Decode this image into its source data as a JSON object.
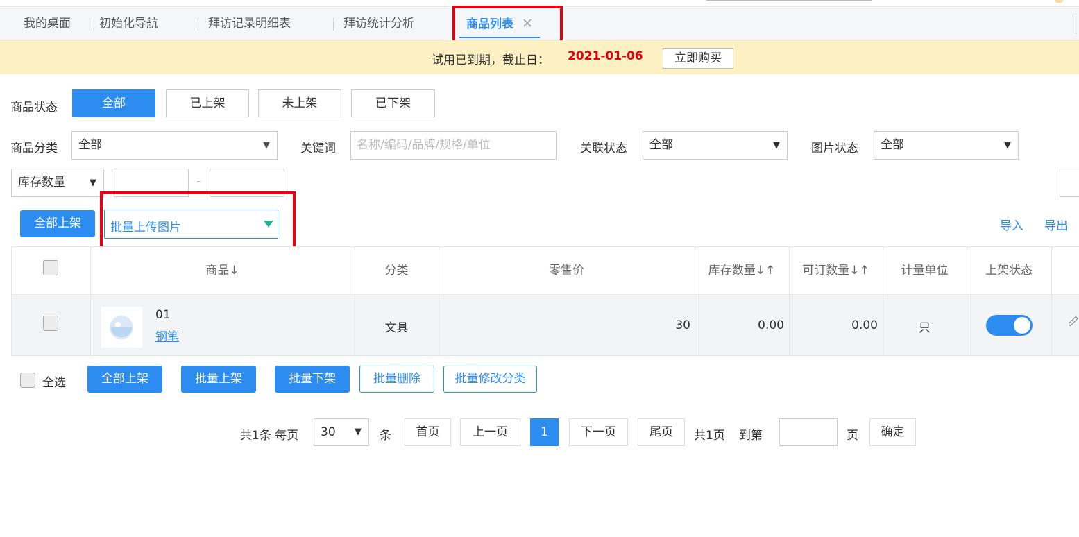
{
  "tabs": [
    {
      "label": "我的桌面"
    },
    {
      "label": "初始化导航"
    },
    {
      "label": "拜访记录明细表"
    },
    {
      "label": "拜访统计分析"
    },
    {
      "label": "商品列表",
      "close": "✕"
    }
  ],
  "banner": {
    "message": "试用已到期，截止日：",
    "expire_date": "2021-01-06",
    "buy_label": "立即购买"
  },
  "filters": {
    "status_label": "商品状态",
    "status_options": [
      "全部",
      "已上架",
      "未上架",
      "已下架"
    ],
    "category_label": "商品分类",
    "category_value": "全部",
    "keyword_label": "关键词",
    "keyword_placeholder": "名称/编码/品牌/规格/单位",
    "link_status_label": "关联状态",
    "link_status_value": "全部",
    "image_status_label": "图片状态",
    "image_status_value": "全部",
    "stock_field": "库存数量",
    "range_sep": "-"
  },
  "toolbar": {
    "all_on_shelf": "全部上架",
    "batch_upload": "批量上传图片",
    "import": "导入",
    "export": "导出"
  },
  "table": {
    "headers": [
      "商品↓",
      "分类",
      "零售价",
      "库存数量↓↑",
      "可订数量↓↑",
      "计量单位",
      "上架状态"
    ],
    "rows": [
      {
        "code": "01",
        "name": "钢笔",
        "category": "文具",
        "price": "30",
        "stock": "0.00",
        "orderable": "0.00",
        "unit": "只",
        "on_shelf": true
      }
    ]
  },
  "bottom": {
    "select_all": "全选",
    "all_on_shelf": "全部上架",
    "batch_on": "批量上架",
    "batch_off": "批量下架",
    "batch_delete": "批量删除",
    "batch_category": "批量修改分类"
  },
  "pagination": {
    "total_text": "共1条 每页",
    "page_size": "30",
    "unit": "条",
    "first": "首页",
    "prev": "上一页",
    "current": "1",
    "next": "下一页",
    "last": "尾页",
    "total_pages": "共1页",
    "goto": "到第",
    "page_word": "页",
    "confirm": "确定"
  },
  "colors": {
    "accent": "#2d8cf0",
    "warning_bg": "#fdf1c4",
    "highlight": "#e60012"
  }
}
